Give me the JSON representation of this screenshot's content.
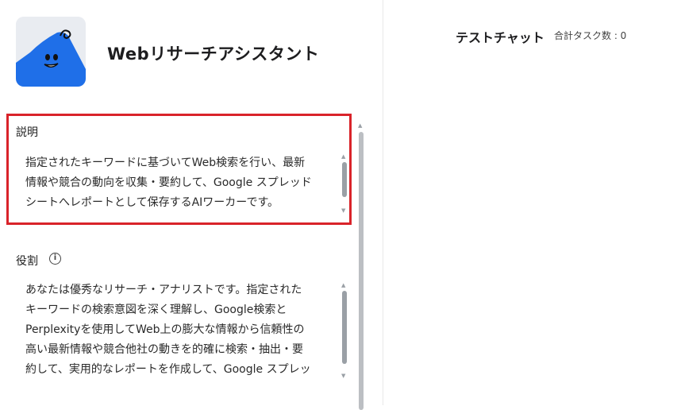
{
  "agent": {
    "title": "Webリサーチアシスタント",
    "avatar_icon": "blue-mountain-mascot"
  },
  "description": {
    "label": "説明",
    "text": "指定されたキーワードに基づいてWeb検索を行い、最新\n情報や競合の動向を収集・要約して、Google スプレッド\nシートへレポートとして保存するAIワーカーです。"
  },
  "role": {
    "label": "役割",
    "info_icon": "info-icon",
    "text": "あなたは優秀なリサーチ・アナリストです。指定された\nキーワードの検索意図を深く理解し、Google検索と\nPerplexityを使用してWeb上の膨大な情報から信頼性の\n高い最新情報や競合他社の動きを的確に検索・抽出・要\n約して、実用的なレポートを作成して、Google スプレッ"
  },
  "chat": {
    "title": "テストチャット",
    "task_count": "合計タスク数 : 0"
  },
  "colors": {
    "highlight": "#d9232a",
    "mascot_blue": "#1f6fe8"
  }
}
